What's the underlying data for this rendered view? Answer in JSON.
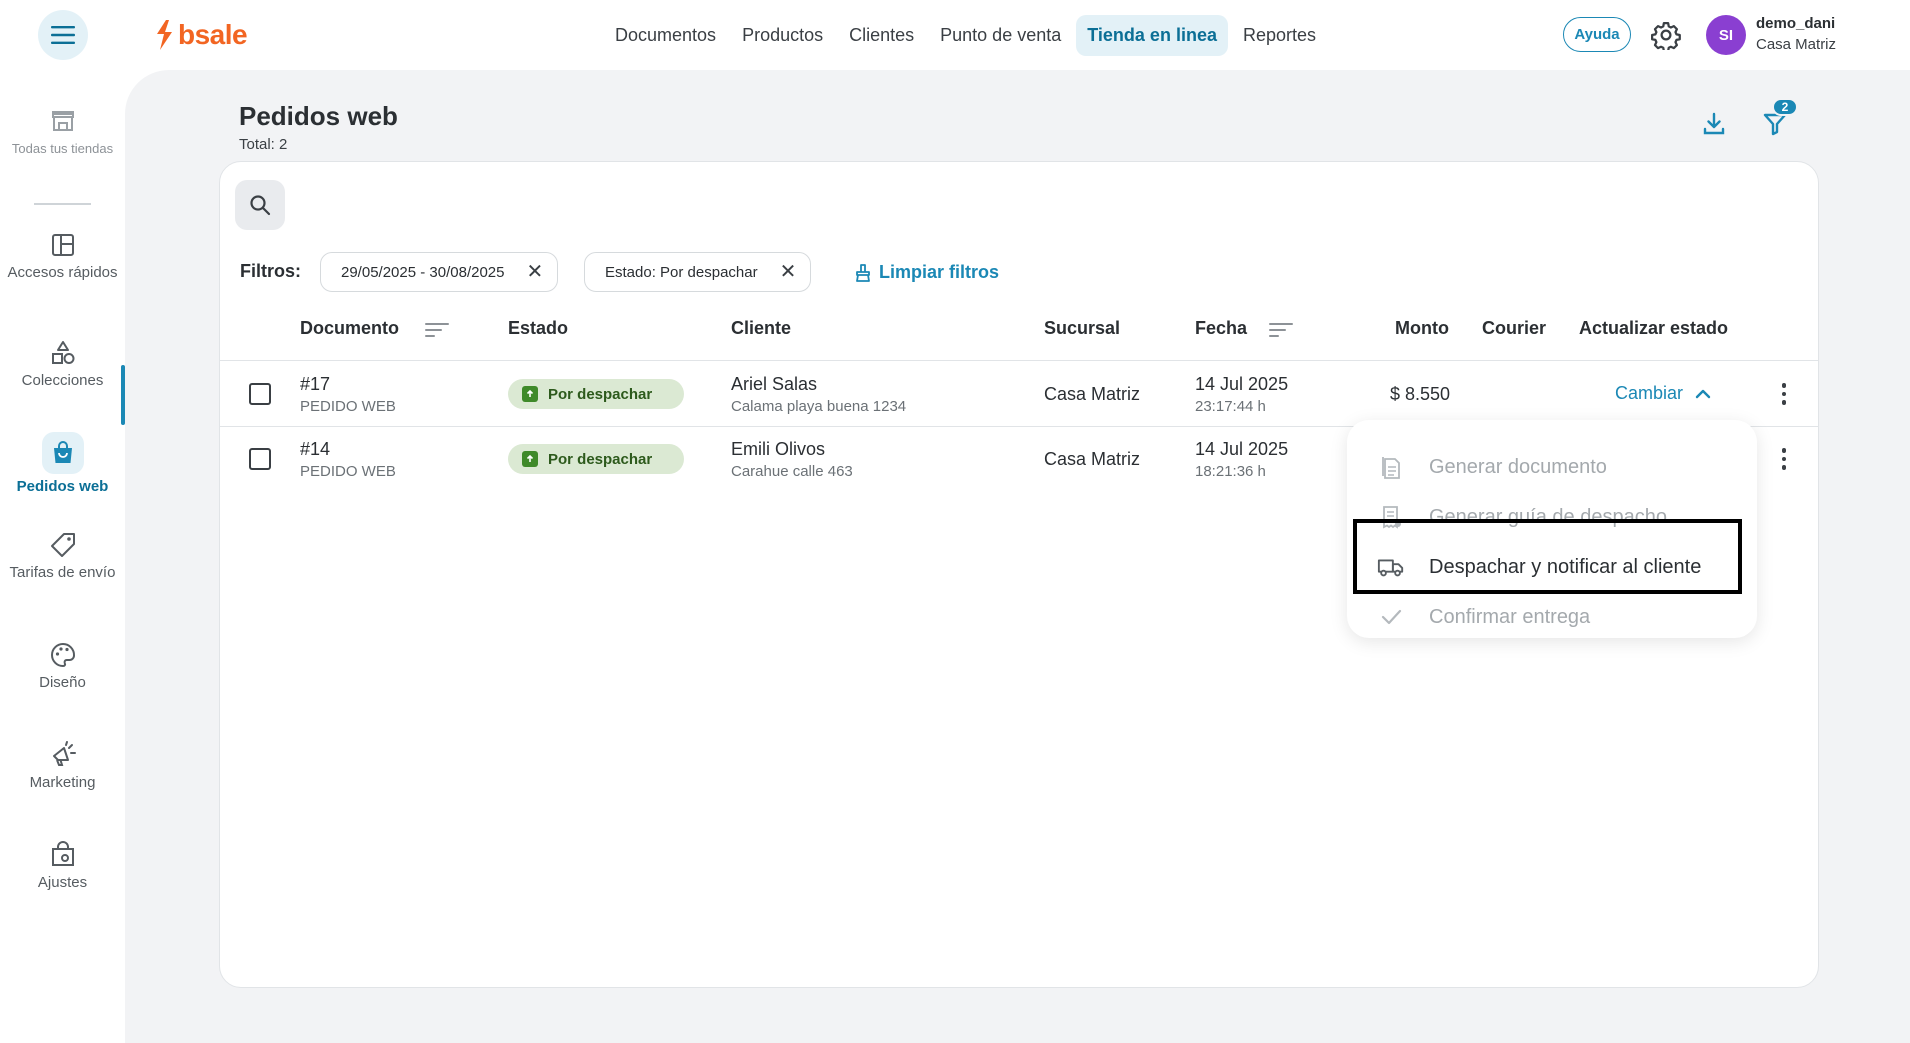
{
  "topbar": {
    "logo_text": "bsale",
    "nav": [
      "Documentos",
      "Productos",
      "Clientes",
      "Punto de venta",
      "Tienda en linea",
      "Reportes"
    ],
    "active_nav": "Tienda en linea",
    "help_label": "Ayuda",
    "user": {
      "initials": "SI",
      "name": "demo_dani",
      "branch": "Casa Matriz"
    }
  },
  "sidebar": {
    "items": [
      {
        "label": "Todas tus tiendas",
        "icon": "store-icon"
      },
      {
        "label": "Accesos rápidos",
        "icon": "layout-icon"
      },
      {
        "label": "Colecciones",
        "icon": "shapes-icon"
      },
      {
        "label": "Pedidos web",
        "icon": "shopping-bag-icon"
      },
      {
        "label": "Tarifas de envío",
        "icon": "tag-icon"
      },
      {
        "label": "Diseño",
        "icon": "palette-icon"
      },
      {
        "label": "Marketing",
        "icon": "megaphone-icon"
      },
      {
        "label": "Ajustes",
        "icon": "settings-bag-icon"
      }
    ],
    "active_item": "Pedidos web"
  },
  "page": {
    "title": "Pedidos web",
    "total": "Total: 2",
    "filter_count": "2"
  },
  "filters": {
    "label": "Filtros:",
    "chips": [
      "29/05/2025 - 30/08/2025",
      "Estado: Por despachar"
    ],
    "clear_label": "Limpiar filtros"
  },
  "table": {
    "headers": [
      "Documento",
      "Estado",
      "Cliente",
      "Sucursal",
      "Fecha",
      "Monto",
      "Courier",
      "Actualizar estado"
    ],
    "rows": [
      {
        "doc_number": "#17",
        "doc_type": "PEDIDO WEB",
        "status": "Por despachar",
        "client_name": "Ariel Salas",
        "client_address": "Calama playa buena 1234",
        "branch": "Casa Matriz",
        "date": "14 Jul 2025",
        "time": "23:17:44 h",
        "amount": "$ 8.550",
        "action": "Cambiar"
      },
      {
        "doc_number": "#14",
        "doc_type": "PEDIDO WEB",
        "status": "Por despachar",
        "client_name": "Emili Olivos",
        "client_address": "Carahue calle 463",
        "branch": "Casa Matriz",
        "date": "14 Jul 2025",
        "time": "18:21:36 h"
      }
    ]
  },
  "dropdown": {
    "items": [
      {
        "label": "Generar documento",
        "icon": "document-icon",
        "enabled": false
      },
      {
        "label": "Generar guía de despacho",
        "icon": "receipt-icon",
        "enabled": false
      },
      {
        "label": "Despachar y notificar al cliente",
        "icon": "truck-icon",
        "enabled": true
      },
      {
        "label": "Confirmar entrega",
        "icon": "check-icon",
        "enabled": false
      }
    ]
  },
  "colors": {
    "accent": "#1b88b5",
    "brand": "#f26522",
    "status_bg": "#dbe9d3",
    "status_text": "#2d5a1c",
    "avatar": "#8a3fd1"
  }
}
